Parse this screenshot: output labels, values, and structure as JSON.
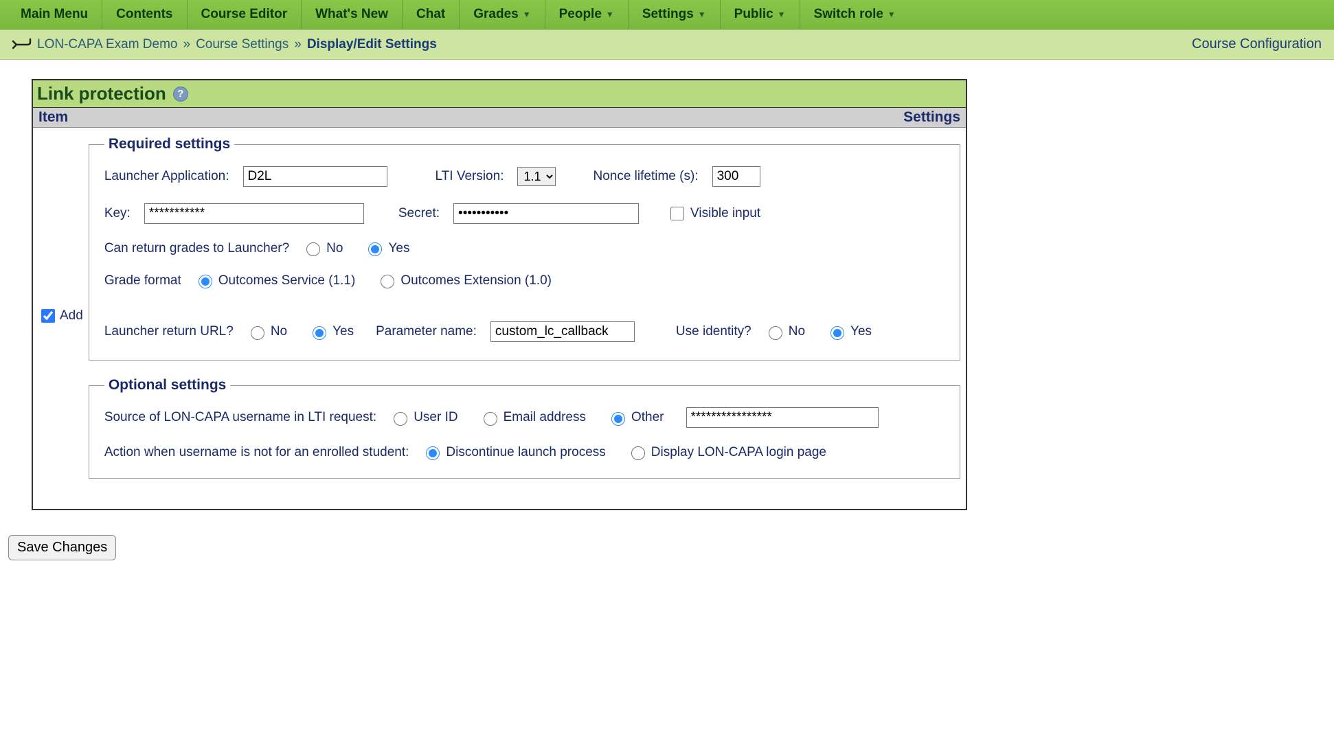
{
  "nav": {
    "items": [
      {
        "label": "Main Menu",
        "dropdown": false
      },
      {
        "label": "Contents",
        "dropdown": false
      },
      {
        "label": "Course Editor",
        "dropdown": false
      },
      {
        "label": "What's New",
        "dropdown": false
      },
      {
        "label": "Chat",
        "dropdown": false
      },
      {
        "label": "Grades",
        "dropdown": true
      },
      {
        "label": "People",
        "dropdown": true
      },
      {
        "label": "Settings",
        "dropdown": true
      },
      {
        "label": "Public",
        "dropdown": true
      },
      {
        "label": "Switch role",
        "dropdown": true
      }
    ]
  },
  "breadcrumb": {
    "items": [
      {
        "label": "LON-CAPA Exam Demo",
        "current": false
      },
      {
        "label": "Course Settings",
        "current": false
      },
      {
        "label": "Display/Edit Settings",
        "current": true
      }
    ],
    "sep": "»",
    "right": "Course Configuration"
  },
  "panel": {
    "title": "Link protection",
    "col_item": "Item",
    "col_settings": "Settings",
    "add_label": "Add",
    "add_checked": true
  },
  "required": {
    "legend": "Required settings",
    "launcher_app_label": "Launcher Application:",
    "launcher_app_value": "D2L",
    "lti_version_label": "LTI Version:",
    "lti_version_value": "1.1",
    "nonce_label": "Nonce lifetime (s):",
    "nonce_value": "300",
    "key_label": "Key:",
    "key_value": "***********",
    "secret_label": "Secret:",
    "secret_value": "•••••••••••",
    "visible_input_label": "Visible input",
    "visible_input_checked": false,
    "return_grades_label": "Can return grades to Launcher?",
    "no": "No",
    "yes": "Yes",
    "return_grades_value": "Yes",
    "grade_format_label": "Grade format",
    "grade_format_opt1": "Outcomes Service (1.1)",
    "grade_format_opt2": "Outcomes Extension (1.0)",
    "grade_format_value": "Outcomes Service (1.1)",
    "return_url_label": "Launcher return URL?",
    "return_url_value": "Yes",
    "param_name_label": "Parameter name:",
    "param_name_value": "custom_lc_callback",
    "use_identity_label": "Use identity?",
    "use_identity_value": "Yes"
  },
  "optional": {
    "legend": "Optional settings",
    "source_label": "Source of LON-CAPA username in LTI request:",
    "source_opt1": "User ID",
    "source_opt2": "Email address",
    "source_opt3": "Other",
    "source_value": "Other",
    "other_value": "****************",
    "action_label": "Action when username is not for an enrolled student:",
    "action_opt1": "Discontinue launch process",
    "action_opt2": "Display LON-CAPA login page",
    "action_value": "Discontinue launch process"
  },
  "save_button": "Save Changes"
}
